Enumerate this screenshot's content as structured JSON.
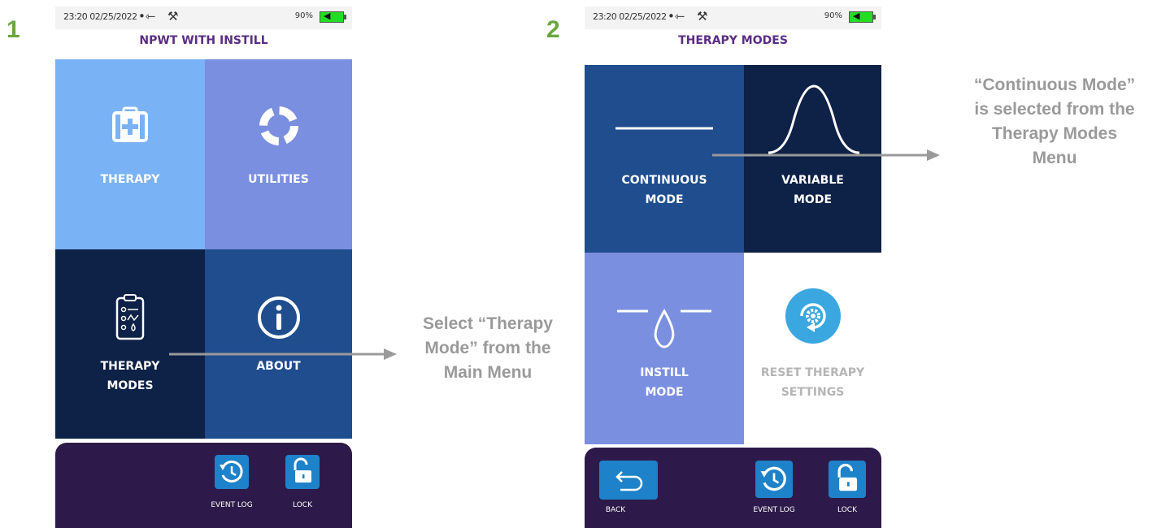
{
  "step1": {
    "number": "1",
    "status": {
      "datetime": "23:20 02/25/2022",
      "battery_percent": "90%"
    },
    "title": "NPWT WITH INSTILL",
    "tiles": [
      {
        "label": "THERAPY",
        "icon": "first-aid-kit-icon",
        "color": "#7ab3f5"
      },
      {
        "label": "UTILITIES",
        "icon": "lifebuoy-icon",
        "color": "#7b8fe0"
      },
      {
        "label_line1": "THERAPY",
        "label_line2": "MODES",
        "icon": "clipboard-icon",
        "color": "#0e2147"
      },
      {
        "label": "ABOUT",
        "icon": "info-icon",
        "color": "#1f4d8e"
      }
    ],
    "buttons": [
      {
        "label": "EVENT LOG",
        "icon": "history-icon"
      },
      {
        "label": "LOCK",
        "icon": "unlock-icon"
      }
    ]
  },
  "step2": {
    "number": "2",
    "status": {
      "datetime": "23:20 02/25/2022",
      "battery_percent": "90%"
    },
    "title": "THERAPY MODES",
    "tiles": [
      {
        "label_line1": "CONTINUOUS",
        "label_line2": "MODE",
        "icon": "flat-line-icon",
        "color": "#1f4d8e"
      },
      {
        "label_line1": "VARIABLE",
        "label_line2": "MODE",
        "icon": "wave-icon",
        "color": "#0e2147"
      },
      {
        "label_line1": "INSTILL",
        "label_line2": "MODE",
        "icon": "droplet-icon",
        "color": "#7b8fe0"
      },
      {
        "label_line1": "RESET THERAPY",
        "label_line2": "SETTINGS",
        "icon": "reset-gear-icon",
        "color": "#ffffff"
      }
    ],
    "buttons": [
      {
        "label": "BACK",
        "icon": "back-arrow-icon"
      },
      {
        "label": "EVENT LOG",
        "icon": "history-icon"
      },
      {
        "label": "LOCK",
        "icon": "unlock-icon"
      }
    ]
  },
  "callout1": {
    "line1": "Select “Therapy",
    "line2": "Mode” from the",
    "line3": "Main Menu"
  },
  "callout2": {
    "line1": "“Continuous Mode”",
    "line2": "is selected from the",
    "line3": "Therapy Modes",
    "line4": "Menu"
  },
  "colors": {
    "step_number": "#6aa83f",
    "title": "#5b2d84",
    "callout_text": "#9a9a9a",
    "arrow": "#9a9a9a",
    "button": "#1d82c9",
    "bottom_bar": "#2e1a4a"
  }
}
